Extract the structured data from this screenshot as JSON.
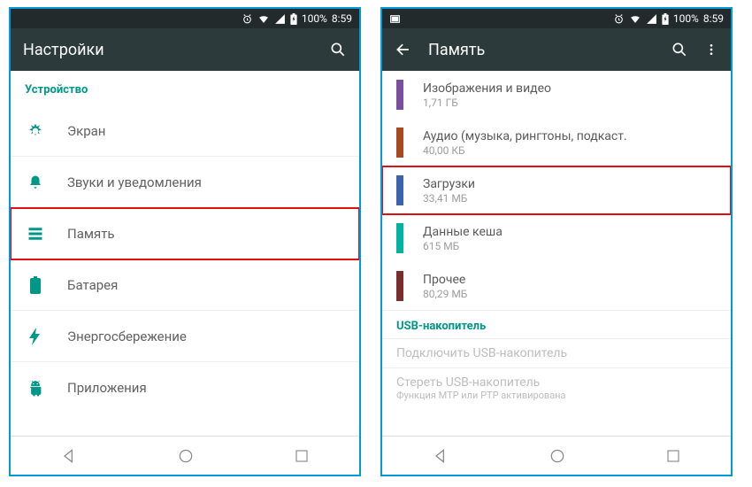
{
  "status": {
    "battery": "100%",
    "time": "8:59"
  },
  "left": {
    "title": "Настройки",
    "section": "Устройство",
    "items": [
      {
        "label": "Экран"
      },
      {
        "label": "Звуки и уведомления"
      },
      {
        "label": "Память"
      },
      {
        "label": "Батарея"
      },
      {
        "label": "Энергосбережение"
      },
      {
        "label": "Приложения"
      }
    ]
  },
  "right": {
    "title": "Память",
    "storage": [
      {
        "label": "Изображения и видео",
        "size": "1,71 ГБ",
        "color": "#7b4fa0"
      },
      {
        "label": "Аудио (музыка, рингтоны, подкаст.",
        "size": "40,00 КБ",
        "color": "#a84a1f"
      },
      {
        "label": "Загрузки",
        "size": "33,41 МБ",
        "color": "#3a62ad"
      },
      {
        "label": "Данные кеша",
        "size": "615 МБ",
        "color": "#00b2a0"
      },
      {
        "label": "Прочее",
        "size": "80,29 МБ",
        "color": "#7a2d2d"
      }
    ],
    "usb_section": "USB-накопитель",
    "usb_items": [
      {
        "label": "Подключить USB-накопитель",
        "sub": ""
      },
      {
        "label": "Стереть USB-накопитель",
        "sub": "Функция MTP или PTP активирована"
      }
    ]
  }
}
